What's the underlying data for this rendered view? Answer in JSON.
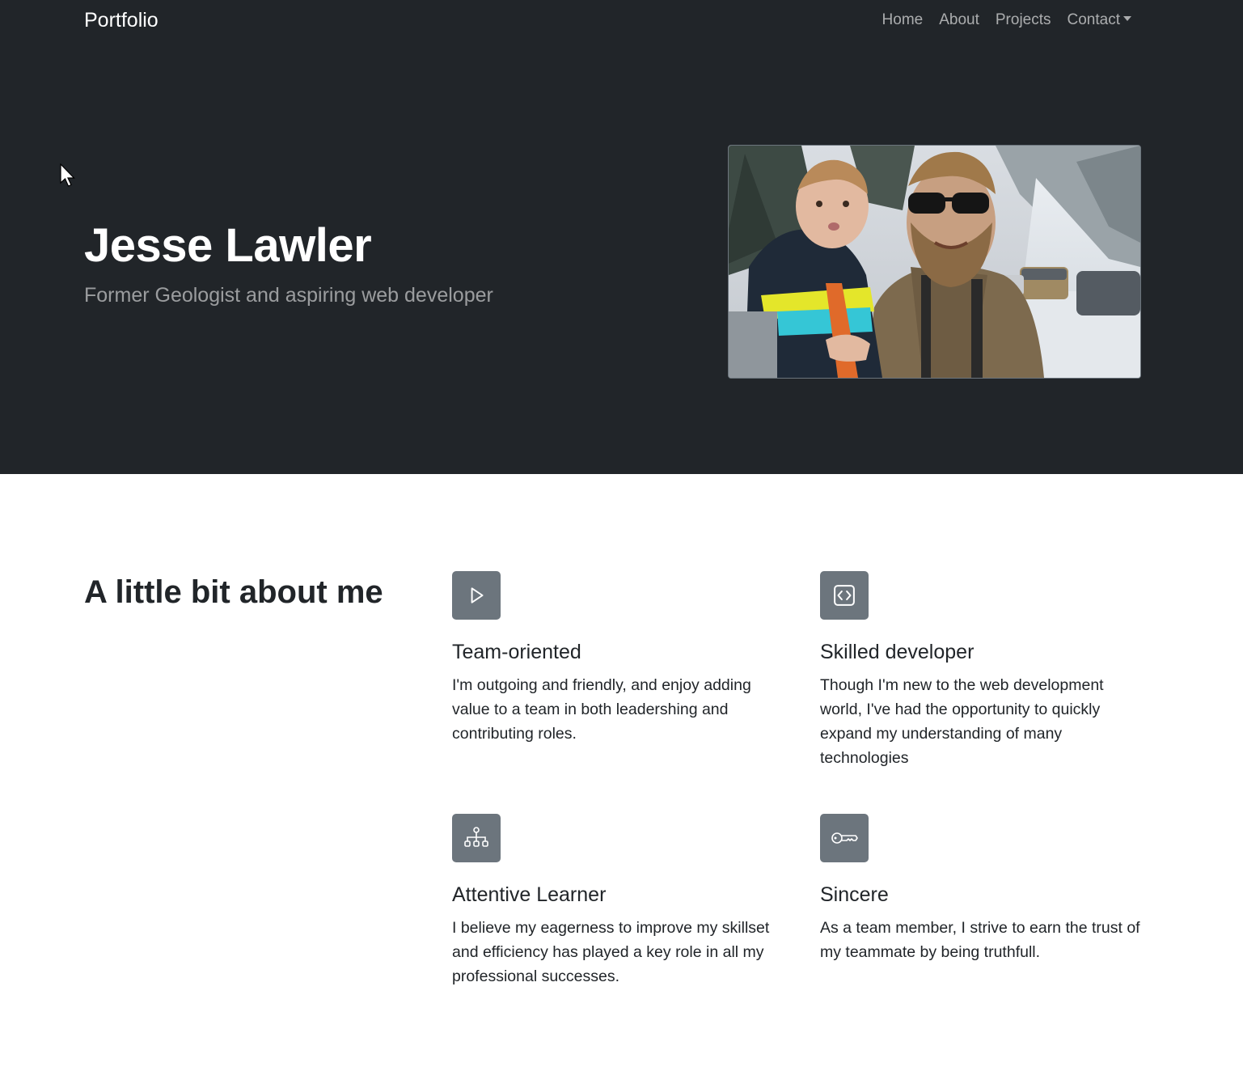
{
  "navbar": {
    "brand": "Portfolio",
    "links": [
      {
        "label": "Home"
      },
      {
        "label": "About"
      },
      {
        "label": "Projects"
      },
      {
        "label": "Contact"
      }
    ]
  },
  "hero": {
    "name": "Jesse Lawler",
    "tagline": "Former Geologist and aspiring web developer"
  },
  "about": {
    "heading": "A little bit about me",
    "features": [
      {
        "icon": "play-icon",
        "title": "Team-oriented",
        "text": "I'm outgoing and friendly, and enjoy adding value to a team in both leadershing and contributing roles."
      },
      {
        "icon": "code-icon",
        "title": "Skilled developer",
        "text": "Though I'm new to the web development world, I've had the opportunity to quickly expand my understanding of many technologies"
      },
      {
        "icon": "network-icon",
        "title": "Attentive Learner",
        "text": "I believe my eagerness to improve my skillset and efficiency has played a key role in all my professional successes."
      },
      {
        "icon": "key-icon",
        "title": "Sincere",
        "text": "As a team member, I strive to earn the trust of my teammate by being truthfull."
      }
    ]
  },
  "colors": {
    "dark": "#212529",
    "icon_bg": "#6c757d",
    "nav_text": "#9a9da0"
  }
}
